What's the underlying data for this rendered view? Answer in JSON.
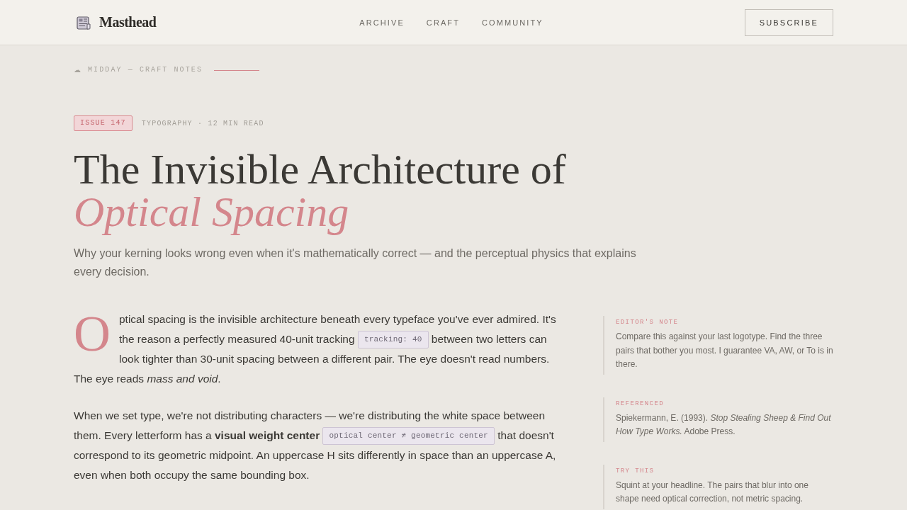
{
  "header": {
    "brand": "Masthead",
    "nav": [
      "ARCHIVE",
      "CRAFT",
      "COMMUNITY"
    ],
    "subscribe": "SUBSCRIBE"
  },
  "kicker": {
    "icon": "☁",
    "text": "MIDDAY — CRAFT NOTES"
  },
  "article": {
    "badge": "ISSUE 147",
    "meta": "TYPOGRAPHY · 12 MIN READ",
    "title": "The Invisible Architecture of *Optical Spacing*",
    "dek": "Why your kerning looks wrong even when it's mathematically correct — and the perceptual physics that explains every decision.",
    "paragraphs": [
      {
        "drop_cap": "O",
        "parts": [
          {
            "kind": "text",
            "text": "ptical spacing is the invisible architecture beneath every typeface you've ever admired. It's the reason a perfectly measured 40-unit tracking"
          },
          {
            "kind": "code",
            "text": "tracking: 40"
          },
          {
            "kind": "text",
            "text": "between two letters can look tighter than 30-unit spacing between a different pair. The eye doesn't read numbers. The eye reads *mass and void*."
          }
        ]
      },
      {
        "parts": [
          {
            "kind": "text",
            "text": "When we set type, we're not distributing characters — we're distributing the white space between them. Every letterform has a **visual weight center**"
          },
          {
            "kind": "code",
            "text": "optical center ≠ geometric center"
          },
          {
            "kind": "text",
            "text": "that doesn't correspond to its geometric midpoint. An uppercase H sits differently in space than an uppercase A, even when both occupy the same bounding box."
          }
        ]
      }
    ]
  },
  "notes": [
    {
      "label": "EDITOR'S NOTE",
      "text": "Compare this against your last logotype. Find the three pairs that bother you most. I guarantee VA, AW, or To is in there."
    },
    {
      "label": "REFERENCED",
      "text": "Spiekermann, E. (1993). *Stop Stealing Sheep & Find Out How Type Works.* Adobe Press."
    },
    {
      "label": "TRY THIS",
      "text": "Squint at your headline. The pairs that blur into one shape need optical correction, not metric spacing."
    }
  ]
}
